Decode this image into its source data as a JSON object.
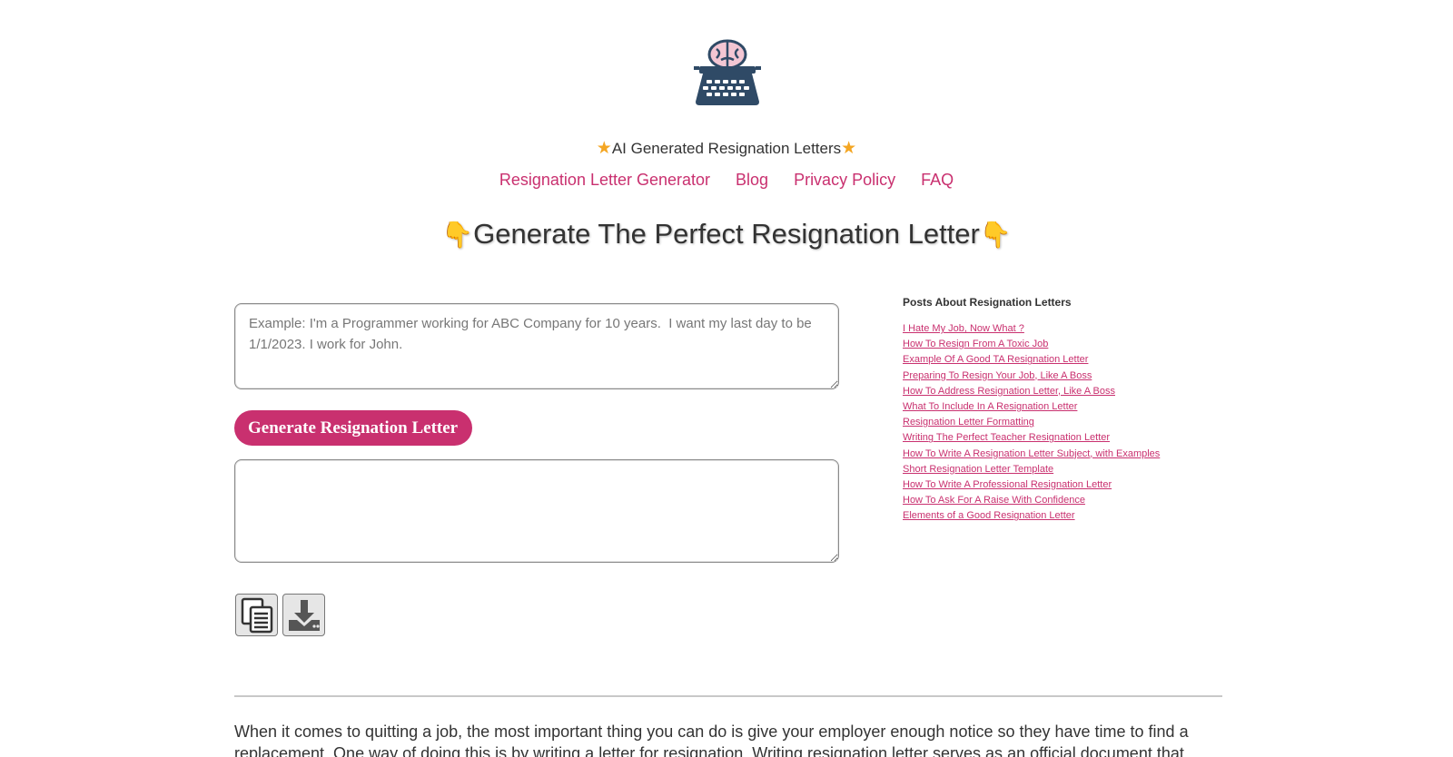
{
  "brand": {
    "tagline": "AI Generated Resignation Letters",
    "logo_icon": "brain-typewriter-icon",
    "star_icon": "star-icon"
  },
  "nav": {
    "items": [
      {
        "label": "Resignation Letter Generator"
      },
      {
        "label": "Blog"
      },
      {
        "label": "Privacy Policy"
      },
      {
        "label": "FAQ"
      }
    ]
  },
  "headline": {
    "text": "Generate The Perfect Resignation Letter",
    "hand_icon": "pointing-down-hand-icon"
  },
  "prompt_input": {
    "placeholder": "Example: I'm a Programmer working for ABC Company for 10 years.  I want my last day to be 1/1/2023. I work for John.",
    "value": ""
  },
  "generate_button": {
    "label": "Generate Resignation Letter"
  },
  "output": {
    "value": ""
  },
  "actions": {
    "copy_icon": "copy-icon",
    "download_icon": "download-icon"
  },
  "sidebar": {
    "title": "Posts About Resignation Letters",
    "links": [
      "I Hate My Job, Now What ?",
      "How To Resign From A Toxic Job",
      "Example Of A Good TA Resignation Letter",
      "Preparing To Resign Your Job, Like A Boss",
      "How To Address Resignation Letter, Like A Boss",
      "What To Include In A Resignation Letter",
      "Resignation Letter Formatting",
      "Writing The Perfect Teacher Resignation Letter",
      "How To Write A Resignation Letter Subject, with Examples",
      "Short Resignation Letter Template",
      "How To Write A Professional Resignation Letter",
      "How To Ask For A Raise With Confidence",
      "Elements of a Good Resignation Letter"
    ]
  },
  "intro": {
    "text": "When it comes to quitting a job, the most important thing you can do is give your employer enough notice so they have time to find a replacement. One way of doing this is by writing a letter for resignation. Writing resignation letter serves as an official document that"
  },
  "colors": {
    "accent": "#c9306f",
    "star": "#f4a623",
    "logo_dark": "#2f4a66",
    "logo_pink": "#f3c6d3"
  }
}
